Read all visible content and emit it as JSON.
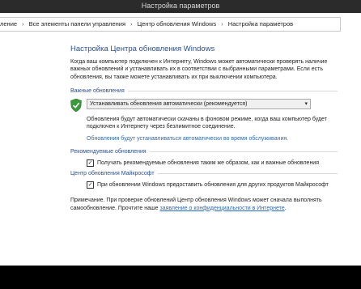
{
  "window": {
    "title": "Настройка параметров"
  },
  "breadcrumb": {
    "items": [
      "ление",
      "Все элементы панели управления",
      "Центр обновления Windows",
      "Настройка параметров"
    ]
  },
  "page": {
    "title": "Настройка Центра обновления Windows",
    "description": "Когда ваш компьютер подключен к Интернету, Windows может автоматически проверять наличие важных обновлений и устанавливать их в соответствии с выбранными параметрами. Если есть обновления, вы также можете устанавливать их при выключении компьютера."
  },
  "important": {
    "heading": "Важные обновления",
    "select_value": "Устанавливать обновления автоматически (рекомендуется)",
    "note": "Обновления будут автоматически скачаны в фоновом режиме, когда ваш компьютер будет подключен к Интернету через безлимитное соединение.",
    "link": "Обновления будут устанавливаться автоматически во время обслуживания."
  },
  "recommended": {
    "heading": "Рекомендуемые обновления",
    "checkbox_label": "Получать рекомендуемые обновления таким же образом, как и важные обновления",
    "checked": true
  },
  "microsoft": {
    "heading": "Центр обновления Майкрософт",
    "checkbox_label": "При обновлении Windows предоставить обновления для других продуктов Майкрософт",
    "checked": true
  },
  "footer": {
    "text": "Примечание. При проверке обновлений Центр обновления Windows может сначала выполнять самообновление. Прочтите наше",
    "link": "заявление о конфиденциальности в Интернете",
    "suffix": "."
  },
  "colors": {
    "accent": "#2a4f8f",
    "link": "#2a6ab8",
    "titlebar": "#2b2b2b"
  },
  "icons": [
    "shield-icon",
    "chevron-down-icon",
    "checkmark-icon"
  ]
}
